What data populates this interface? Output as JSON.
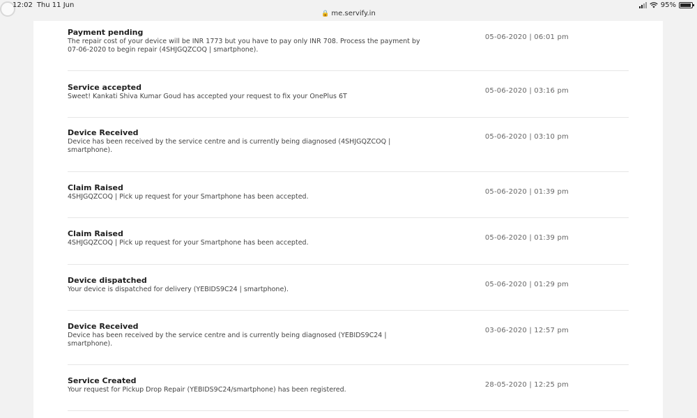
{
  "status_bar": {
    "time": "12:02",
    "date": "Thu 11 Jun",
    "battery": "95%",
    "battery_level": 0.95
  },
  "url": {
    "domain": "me.servify.in"
  },
  "notifications": [
    {
      "title": "Payment pending",
      "desc": "The repair cost of your device will be INR 1773 but you have to pay only INR 708. Process the payment by 07-06-2020 to begin repair (4SHJGQZCOQ | smartphone).",
      "time": "05-06-2020 | 06:01 pm"
    },
    {
      "title": "Service accepted",
      "desc": "Sweet! Kankati Shiva Kumar Goud has accepted your request to fix your OnePlus 6T",
      "time": "05-06-2020 | 03:16 pm"
    },
    {
      "title": "Device Received",
      "desc": "Device has been received by the service centre and is currently being diagnosed (4SHJGQZCOQ | smartphone).",
      "time": "05-06-2020 | 03:10 pm"
    },
    {
      "title": "Claim Raised",
      "desc": "4SHJGQZCOQ | Pick up request for your Smartphone has been accepted.",
      "time": "05-06-2020 | 01:39 pm"
    },
    {
      "title": "Claim Raised",
      "desc": "4SHJGQZCOQ | Pick up request for your Smartphone has been accepted.",
      "time": "05-06-2020 | 01:39 pm"
    },
    {
      "title": "Device dispatched",
      "desc": "Your device is dispatched for delivery (YEBIDS9C24 | smartphone).",
      "time": "05-06-2020 | 01:29 pm"
    },
    {
      "title": "Device Received",
      "desc": "Device has been received by the service centre and is currently being diagnosed (YEBIDS9C24 | smartphone).",
      "time": "03-06-2020 | 12:57 pm"
    },
    {
      "title": "Service Created",
      "desc": "Your request for Pickup Drop Repair (YEBIDS9C24/smartphone) has been registered.",
      "time": "28-05-2020 | 12:25 pm"
    }
  ]
}
